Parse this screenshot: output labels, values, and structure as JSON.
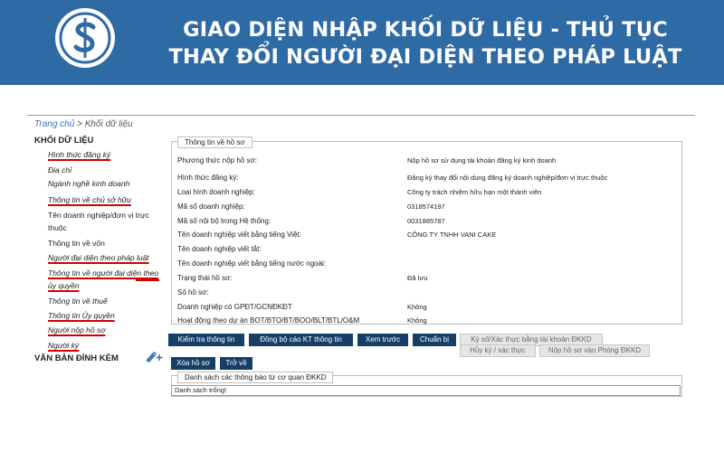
{
  "banner": {
    "title_line1": "GIAO DIỆN NHẬP KHỐI DỮ LIỆU - THỦ TỤC",
    "title_line2": "THAY ĐỔI NGƯỜI ĐẠI DIỆN THEO PHÁP LUẬT",
    "accent_color": "#2e6aa3",
    "logo_icon": "dollar-coin-icon"
  },
  "breadcrumb": {
    "home": "Trang chủ",
    "separator": ">",
    "current": "Khối dữ liệu"
  },
  "sidebar": {
    "heading": "KHỐI DỮ LIỆU",
    "items": [
      {
        "label": "Hình thức đăng ký",
        "highlighted": true
      },
      {
        "label": "Địa chỉ",
        "highlighted": false
      },
      {
        "label": "Ngành nghề kinh doanh",
        "highlighted": false
      },
      {
        "label": "Thông tin về chủ sở hữu",
        "highlighted": true
      },
      {
        "label": "Tên doanh nghiệp/đơn vị trực thuộc",
        "highlighted": false
      },
      {
        "label": "Thông tin về vốn",
        "highlighted": false
      },
      {
        "label": "Người đại diện theo pháp luật",
        "highlighted": true
      },
      {
        "label": "Thông tin về người đại diện theo ủy quyền",
        "highlighted": true
      },
      {
        "label": "Thông tin về thuế",
        "highlighted": false
      },
      {
        "label": "Thông tin Ủy quyền",
        "highlighted": true
      },
      {
        "label": "Người nộp hồ sơ",
        "highlighted": true
      },
      {
        "label": "Người ký",
        "highlighted": true
      }
    ],
    "attachments_heading": "VĂN BẢN ĐÍNH KÈM",
    "attach_icon": "paperclip-plus-icon"
  },
  "profile": {
    "tab_label": "Thông tin về hồ sơ",
    "rows": [
      {
        "label": "Phương thức nộp hồ sơ:",
        "value": "Nộp hồ sơ sử dụng tài khoản đăng ký kinh doanh"
      },
      {
        "label": "Hình thức đăng ký:",
        "value": "Đăng ký thay đổi nội dung đăng ký doanh nghiệp/đơn vị trực thuộc"
      },
      {
        "label": "Loại hình doanh nghiệp:",
        "value": "Công ty trách nhiệm hữu hạn một thành viên"
      },
      {
        "label": "Mã số doanh nghiệp:",
        "value": "0318574197"
      },
      {
        "label": "Mã số nội bộ trong Hệ thống:",
        "value": "0031885787"
      },
      {
        "label": "Tên doanh nghiệp viết bằng tiếng Việt:",
        "value": "CÔNG TY TNHH VANI CAKE"
      },
      {
        "label": "Tên doanh nghiệp viết tắt:",
        "value": ""
      },
      {
        "label": "Tên doanh nghiệp viết bằng tiếng nước ngoài:",
        "value": ""
      },
      {
        "label": "Trạng thái hồ sơ:",
        "value": "Đã lưu"
      },
      {
        "label": "Số hồ sơ:",
        "value": ""
      },
      {
        "label": "Doanh nghiệp có GPĐT/GCNĐKĐT",
        "value": "Không"
      },
      {
        "label": "Hoạt động theo dự án BOT/BTO/BT/BOO/BLT/BTL/O&M",
        "value": "Không"
      }
    ]
  },
  "actions": {
    "check_info": "Kiểm tra thông tin",
    "sync_report": "Đồng bộ cáo KT thông tin",
    "preview": "Xem trước",
    "prepare": "Chuẩn bị",
    "sign_verify": "Ký số/Xác thực bằng tài khoản ĐKKD",
    "cancel_sign": "Hủy ký / xác thực",
    "submit": "Nộp hồ sơ vào Phòng ĐKKD",
    "delete": "Xóa hồ sơ",
    "back": "Trở về"
  },
  "notices": {
    "tab_label": "Danh sách các thông báo từ cơ quan ĐKKD",
    "empty_text": "Danh sách trống!"
  }
}
